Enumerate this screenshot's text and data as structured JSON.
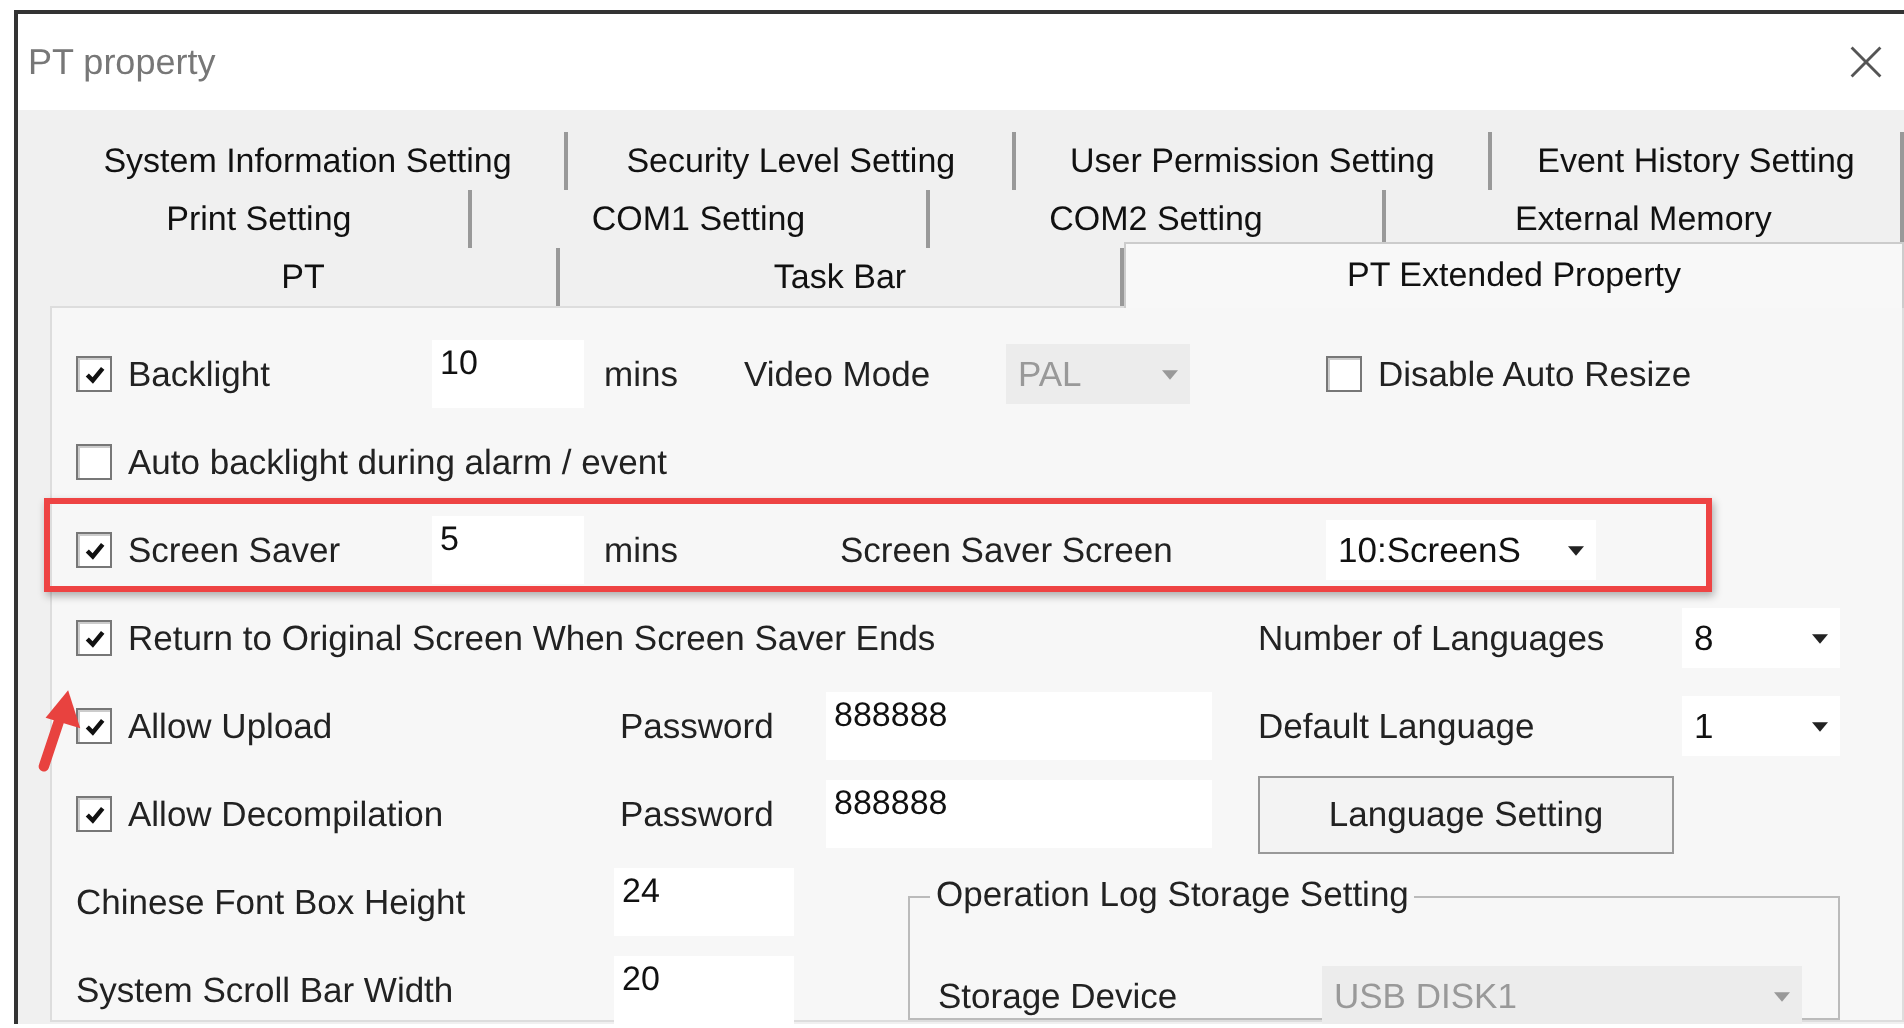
{
  "window": {
    "title": "PT property"
  },
  "tab_rows": [
    [
      {
        "label": "System Information Setting",
        "selected": false
      },
      {
        "label": "Security Level Setting",
        "selected": false
      },
      {
        "label": "User Permission Setting",
        "selected": false
      },
      {
        "label": "Event History Setting",
        "selected": false
      }
    ],
    [
      {
        "label": "Print Setting",
        "selected": false
      },
      {
        "label": "COM1 Setting",
        "selected": false
      },
      {
        "label": "COM2 Setting",
        "selected": false
      },
      {
        "label": "External Memory",
        "selected": false
      }
    ],
    [
      {
        "label": "PT",
        "selected": false
      },
      {
        "label": "Task Bar",
        "selected": false
      },
      {
        "label": "PT Extended Property",
        "selected": true
      }
    ]
  ],
  "rows": [
    {
      "highlighted": false,
      "items": [
        {
          "kind": "checkbox",
          "label": "Backlight",
          "checked": true
        },
        {
          "kind": "input",
          "value": "10"
        },
        {
          "kind": "text",
          "text": "mins"
        },
        {
          "kind": "text",
          "text": "Video Mode"
        },
        {
          "kind": "select",
          "value": "PAL",
          "disabled": true
        },
        {
          "kind": "checkbox",
          "label": "Disable Auto Resize",
          "checked": false
        }
      ]
    },
    {
      "highlighted": false,
      "items": [
        {
          "kind": "checkbox",
          "label": "Auto backlight during alarm / event",
          "checked": false
        }
      ]
    },
    {
      "highlighted": true,
      "items": [
        {
          "kind": "checkbox",
          "label": "Screen Saver",
          "checked": true
        },
        {
          "kind": "input",
          "value": "5"
        },
        {
          "kind": "text",
          "text": "mins"
        },
        {
          "kind": "text",
          "text": "Screen Saver Screen"
        },
        {
          "kind": "select",
          "value": "10:ScreenS",
          "disabled": false
        }
      ]
    },
    {
      "highlighted": false,
      "items": [
        {
          "kind": "checkbox",
          "label": "Return to Original Screen When Screen Saver Ends",
          "checked": true
        },
        {
          "kind": "text",
          "text": "Number of Languages"
        },
        {
          "kind": "select",
          "value": "8",
          "disabled": false
        }
      ]
    },
    {
      "highlighted": false,
      "items": [
        {
          "kind": "checkbox",
          "label": "Allow Upload",
          "checked": true
        },
        {
          "kind": "text",
          "text": "Password"
        },
        {
          "kind": "input",
          "value": "888888"
        },
        {
          "kind": "text",
          "text": "Default Language"
        },
        {
          "kind": "select",
          "value": "1",
          "disabled": false
        }
      ]
    },
    {
      "highlighted": false,
      "items": [
        {
          "kind": "checkbox",
          "label": "Allow Decompilation",
          "checked": true
        },
        {
          "kind": "text",
          "text": "Password"
        },
        {
          "kind": "input",
          "value": "888888"
        },
        {
          "kind": "button",
          "label": "Language Setting"
        }
      ]
    }
  ],
  "sizes": [
    {
      "label": "Chinese Font Box Height",
      "value": "24"
    },
    {
      "label": "System Scroll Bar Width",
      "value": "20"
    }
  ],
  "log_group": {
    "title": "Operation Log Storage Setting",
    "device_label": "Storage Device",
    "device": {
      "value": "USB DISK1",
      "disabled": true
    }
  }
}
